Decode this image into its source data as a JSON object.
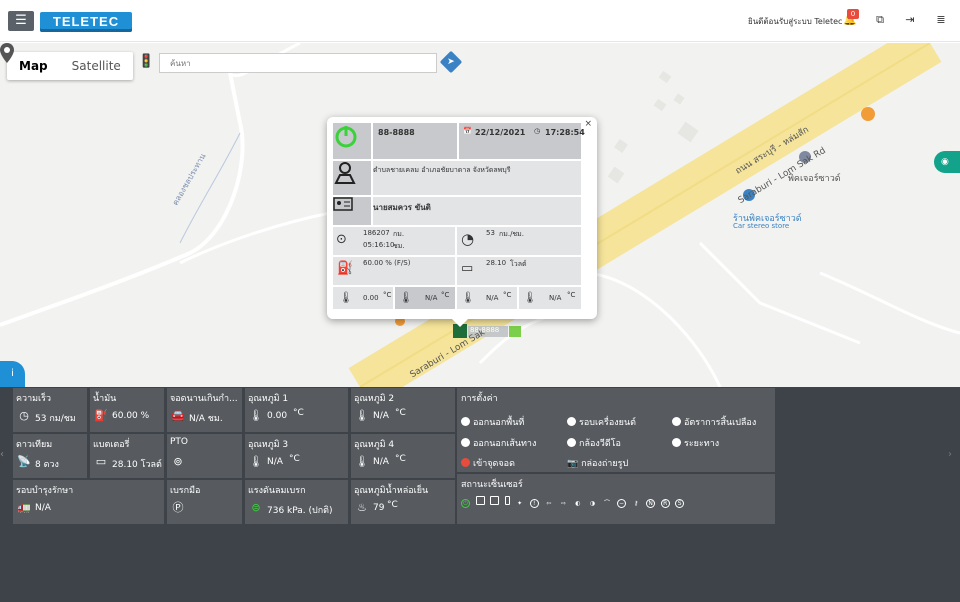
{
  "header": {
    "menu_icon": "hamburger-icon",
    "logo_text": "TELETEC",
    "welcome": "ยินดีต้อนรับสู่ระบบ Teletec",
    "notification_count": "0",
    "icons": [
      "bell-icon",
      "copy-icon",
      "logout-icon",
      "list-icon"
    ]
  },
  "map": {
    "type_map": "Map",
    "type_satellite": "Satellite",
    "search_placeholder": "ค้นหา",
    "labels": {
      "road_north": "ถนน สระบุรี - หล่มสัก",
      "road_en": "Saraburi - Lom Sak Rd",
      "road_bottom": "Saraburi - Lom Sak",
      "canal": "คลองชลประทาน",
      "poi1": "พิคเจอร์ซาวด์",
      "poi2": "ร้านพิคเจอร์ซาวด์",
      "poi2_sub": "Car stereo store",
      "marker_plate": "88-8888"
    }
  },
  "popup": {
    "plate": "88-8888",
    "date": "22/12/2021",
    "time": "17:28:54",
    "address": "ตำบลชายเคลม อำเภอชัยบาดาล จังหวัดลพบุรี",
    "driver": "นายสมควร ขันติ",
    "odometer": "186207",
    "odometer_unit": "กม.",
    "engine_hours": "05:16:10",
    "engine_hours_unit": "ชม.",
    "speed": "53",
    "speed_unit": "กม./ชม.",
    "fuel": "60.00 % (F/S)",
    "battery": "28.10",
    "battery_unit": "โวลต์",
    "temp1": "0.00",
    "temp2": "N/A",
    "temp3": "N/A",
    "temp4": "N/A",
    "temp_unit": "°C",
    "close": "×"
  },
  "panel": {
    "speed": {
      "label": "ความเร็ว",
      "value": "53 กม/ชม"
    },
    "fuel": {
      "label": "น้ำมัน",
      "value": "60.00 %"
    },
    "parking": {
      "label": "จอดนานเกินกำ...",
      "value": "N/A ชม."
    },
    "temp1": {
      "label": "อุณหภูมิ 1",
      "value": "0.00",
      "unit": "°C"
    },
    "temp2": {
      "label": "อุณหภูมิ 2",
      "value": "N/A",
      "unit": "°C"
    },
    "satellite": {
      "label": "ดาวเทียม",
      "value": "8 ดวง"
    },
    "battery": {
      "label": "แบตเตอรี่",
      "value": "28.10 โวลต์"
    },
    "pto": {
      "label": "PTO",
      "value": ""
    },
    "temp3": {
      "label": "อุณหภูมิ 3",
      "value": "N/A",
      "unit": "°C"
    },
    "temp4": {
      "label": "อุณหภูมิ 4",
      "value": "N/A",
      "unit": "°C"
    },
    "maintenance": {
      "label": "รอบบำรุงรักษา",
      "value": "N/A"
    },
    "brake": {
      "label": "เบรกมือ",
      "value": ""
    },
    "brake_pressure": {
      "label": "แรงดันลมเบรก",
      "value": "736 kPa. (ปกติ)"
    },
    "coolant": {
      "label": "อุณหภูมิน้ำหล่อเย็น",
      "value": "79",
      "unit": "°C"
    },
    "settings": {
      "title": "การตั้งค่า",
      "options": [
        "ออกนอกพื้นที่",
        "รอบเครื่องยนต์",
        "อัตราการสิ้นเปลือง",
        "ออกนอกเส้นทาง",
        "กล้องวีดีโอ",
        "ระยะทาง",
        "เข้าจุดจอด",
        "กล่องถ่ายรูป"
      ]
    },
    "sensors": {
      "title": "สถานะเซ็นเซอร์"
    }
  },
  "colors": {
    "panel_bg": "#3e4349",
    "tile_bg": "#575b60",
    "accent_blue": "#1f8fd6",
    "power_green": "#3bd13b",
    "road_yellow": "#f5e49a"
  }
}
